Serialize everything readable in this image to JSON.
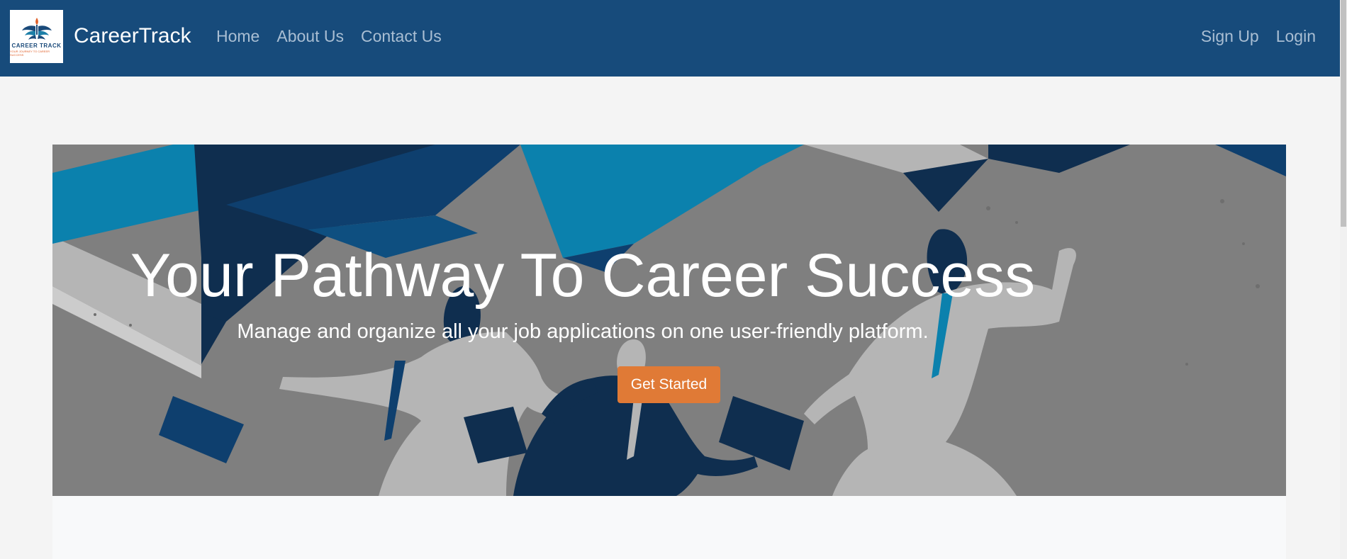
{
  "navbar": {
    "brand": "CareerTrack",
    "logo": {
      "icon": "torch-wings-emblem-icon",
      "text": "CAREER TRACK",
      "tagline": "YOUR JOURNEY TO CAREER SUCCESS"
    },
    "links": [
      {
        "label": "Home"
      },
      {
        "label": "About Us"
      },
      {
        "label": "Contact Us"
      }
    ],
    "right_links": [
      {
        "label": "Sign Up"
      },
      {
        "label": "Login"
      }
    ],
    "background": "#174b7b"
  },
  "hero": {
    "title": "Your Pathway To Career Success",
    "subtitle": "Manage and organize all your job applications on one user-friendly platform.",
    "cta_label": "Get Started",
    "cta_color": "#e07a36",
    "background_image": "business-people-running-illustration"
  }
}
